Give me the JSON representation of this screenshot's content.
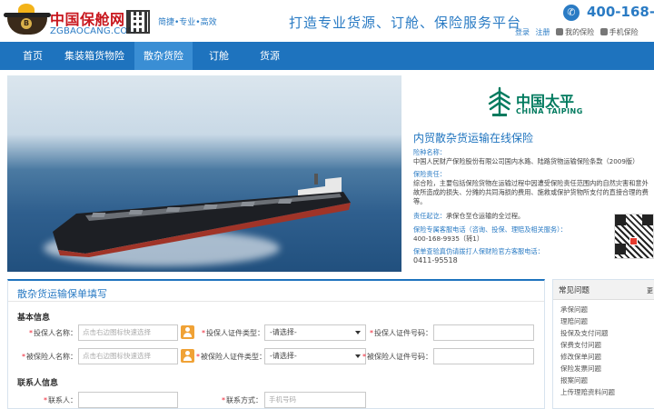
{
  "header": {
    "logo_cn": "中国保舱网",
    "logo_en": "ZGBAOCANG.COM",
    "tagline": "简捷•专业•高效",
    "slogan": "打造专业货源、订舱、保险服务平台",
    "phone": "400-168-99",
    "links": {
      "login": "登录",
      "register": "注册",
      "my_insurance": "我的保险",
      "mobile_insurance": "手机保险"
    }
  },
  "nav": {
    "items": [
      {
        "label": "首页"
      },
      {
        "label": "集装箱货物险"
      },
      {
        "label": "散杂货险"
      },
      {
        "label": "订舱"
      },
      {
        "label": "货源"
      }
    ],
    "active_index": 2
  },
  "product": {
    "insurer_cn": "中国太平",
    "insurer_en": "CHINA TAIPING",
    "title": "内贸散杂货运输在线保险",
    "clause_label": "险种名称：",
    "clause_text": "中国人民财产保险股份有限公司国内水路、陆路货物运输保险条款（2009版）",
    "liability_label": "保险责任：",
    "liability_lines": [
      "综合险，主要包括保险货物在运输过程中因遭受保险责任范围内的自然灾害和意外",
      "故所造成的损失、分摊的共同海损的费用、施救或保护货物所支付的直接合理的费",
      "等。"
    ],
    "period_label": "责任起讫：",
    "period_text": "承保仓至仓运输的全过程。",
    "hotline_label": "保险专属客服电话（咨询、投保、理赔及相关服务）：",
    "hotline": "400-168-9935（转1）",
    "claims_label": "保单查验真伪请拨打人保财险官方客服电话：",
    "claims_phone": "0411-95518"
  },
  "form": {
    "title": "散杂货运输保单填写",
    "basic_section": "基本信息",
    "contact_section": "联系人信息",
    "applicant_name_label": "投保人名称：",
    "applicant_name_placeholder": "点击右边图标快速选择",
    "applicant_id_type_label": "投保人证件类型：",
    "applicant_id_type_value": "-请选择-",
    "applicant_id_no_label": "投保人证件号码：",
    "insured_name_label": "被保险人名称：",
    "insured_name_placeholder": "点击右边图标快速选择",
    "insured_id_type_label": "被保险人证件类型：",
    "insured_id_type_value": "-请选择-",
    "insured_id_no_label": "被保险人证件号码：",
    "contact_label": "联系人：",
    "contact_method_label": "联系方式：",
    "contact_method_placeholder": "手机号码"
  },
  "faq": {
    "title": "常见问题",
    "more": "更",
    "items": [
      "承保问题",
      "理赔问题",
      "投保及支付问题",
      "保费支付问题",
      "修改保单问题",
      "保险发票问题",
      "报案问题",
      "上传理赔资料问题"
    ]
  },
  "colors": {
    "brand_blue": "#1e73be",
    "nav_active": "#3a8ed4",
    "taiping_green": "#007a5e",
    "logo_red": "#c8161d"
  }
}
